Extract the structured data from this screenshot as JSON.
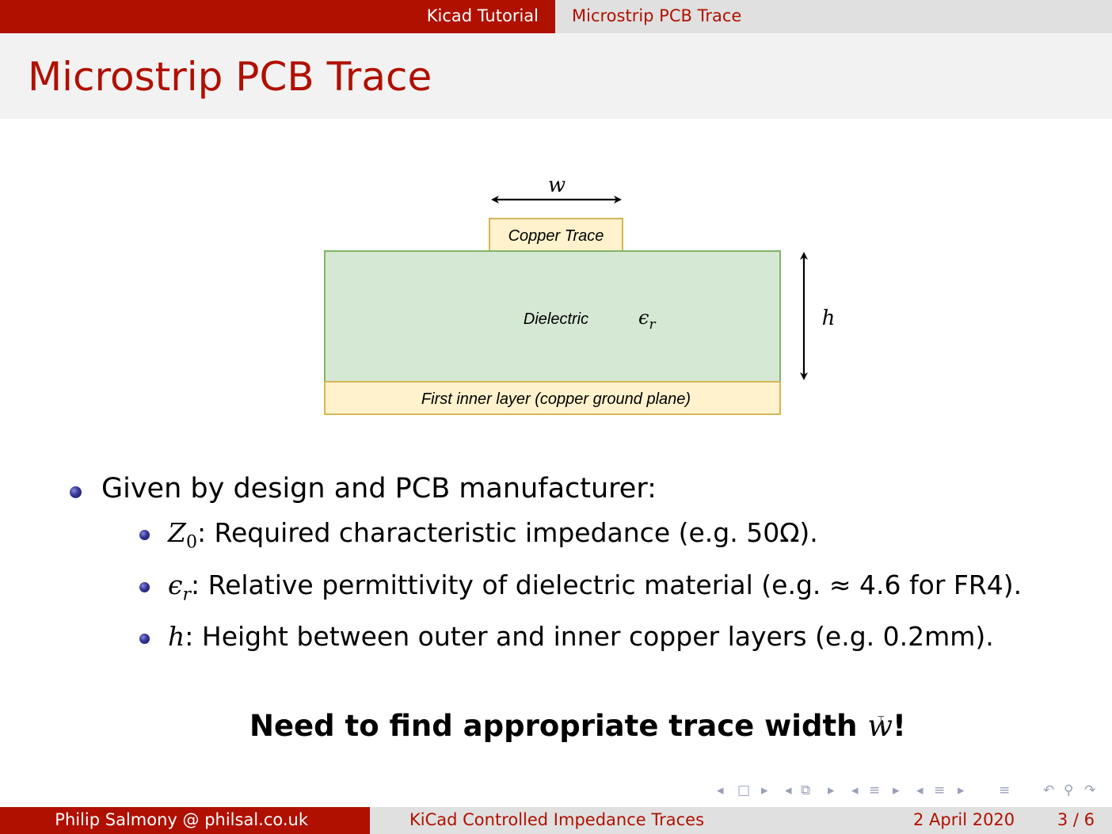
{
  "header": {
    "section": "Kicad Tutorial",
    "subsection": "Microstrip PCB Trace"
  },
  "title": "Microstrip PCB Trace",
  "diagram": {
    "width_label": "w",
    "trace_label": "Copper Trace",
    "dielectric_label": "Dielectric",
    "epsilon_label": "ϵ",
    "epsilon_sub": "r",
    "height_label": "h",
    "ground_label": "First inner layer (copper ground plane)",
    "colors": {
      "copper": "#fff2cc",
      "copper_border": "#d6b656",
      "dielectric": "#d5e8d4",
      "dielectric_border": "#82b366"
    }
  },
  "bullets": {
    "main": "Given by design and PCB manufacturer:",
    "sub": [
      {
        "symbol": "Z",
        "symbol_sub": "0",
        "text": ": Required characteristic impedance (e.g. 50Ω)."
      },
      {
        "symbol": "ϵ",
        "symbol_sub": "r",
        "text": ": Relative permittivity of dielectric material (e.g. ≈ 4.6 for FR4)."
      },
      {
        "symbol": "h",
        "symbol_sub": "",
        "text": ": Height between outer and inner copper layers (e.g. 0.2mm)."
      }
    ]
  },
  "callout": {
    "text": "Need to find appropriate trace width ",
    "var": "w",
    "end": "!"
  },
  "nav": {
    "symbols": [
      "◂",
      "□",
      "▸",
      "◂",
      "⧉",
      "▸",
      "◂",
      "≡",
      "▸",
      "◂",
      "≡",
      "▸",
      "≡",
      "↶",
      "⚲",
      "↷"
    ]
  },
  "footer": {
    "author": "Philip Salmony @ philsal.co.uk",
    "talk_title": "KiCad Controlled Impedance Traces",
    "date": "2 April 2020",
    "page": "3 / 6"
  },
  "colors": {
    "accent": "#b01000",
    "bar_grey": "#e0e0e0",
    "title_bg": "#f2f2f2"
  }
}
